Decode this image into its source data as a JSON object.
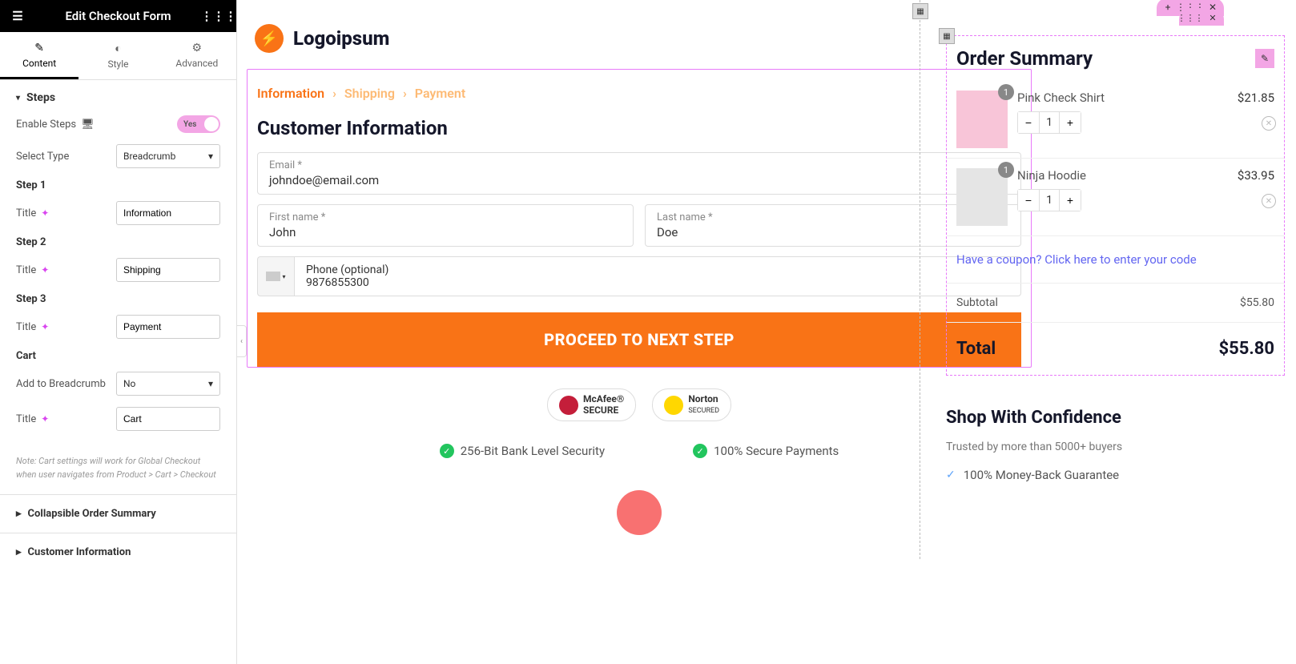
{
  "panel": {
    "title": "Edit Checkout Form",
    "tabs": {
      "content": "Content",
      "style": "Style",
      "advanced": "Advanced"
    },
    "steps": {
      "heading": "Steps",
      "enable_label": "Enable Steps",
      "enable_value": "Yes",
      "select_type_label": "Select Type",
      "select_type_value": "Breadcrumb",
      "step1_heading": "Step 1",
      "title_label": "Title",
      "step1_value": "Information",
      "step2_heading": "Step 2",
      "step2_value": "Shipping",
      "step3_heading": "Step 3",
      "step3_value": "Payment",
      "cart_heading": "Cart",
      "add_bc_label": "Add to Breadcrumb",
      "add_bc_value": "No",
      "cart_title_value": "Cart",
      "note": "Note: Cart settings will work for Global Checkout when user navigates from Product > Cart > Checkout"
    },
    "collapsible1": "Collapsible Order Summary",
    "collapsible2": "Customer Information"
  },
  "checkout": {
    "logo": "Logoipsum",
    "breadcrumb": {
      "info": "Information",
      "shipping": "Shipping",
      "payment": "Payment"
    },
    "section_title": "Customer Information",
    "email_label": "Email *",
    "email_value": "johndoe@email.com",
    "first_name_label": "First name *",
    "first_name_value": "John",
    "last_name_label": "Last name *",
    "last_name_value": "Doe",
    "phone_label": "Phone (optional)",
    "phone_value": "9876855300",
    "proceed": "PROCEED TO NEXT STEP",
    "mcafee": "McAfee",
    "mcafee2": "SECURE",
    "norton": "Norton",
    "norton2": "SECURED",
    "sec1": "256-Bit Bank Level Security",
    "sec2": "100% Secure Payments"
  },
  "summary": {
    "title": "Order Summary",
    "items": [
      {
        "name": "Pink Check Shirt",
        "price": "$21.85",
        "qty": "1"
      },
      {
        "name": "Ninja Hoodie",
        "price": "$33.95",
        "qty": "1"
      }
    ],
    "coupon": "Have a coupon? Click here to enter your code",
    "subtotal_label": "Subtotal",
    "subtotal": "$55.80",
    "total_label": "Total",
    "total": "$55.80"
  },
  "confidence": {
    "title": "Shop With Confidence",
    "sub": "Trusted by more than 5000+ buyers",
    "item1": "100% Money-Back Guarantee"
  }
}
